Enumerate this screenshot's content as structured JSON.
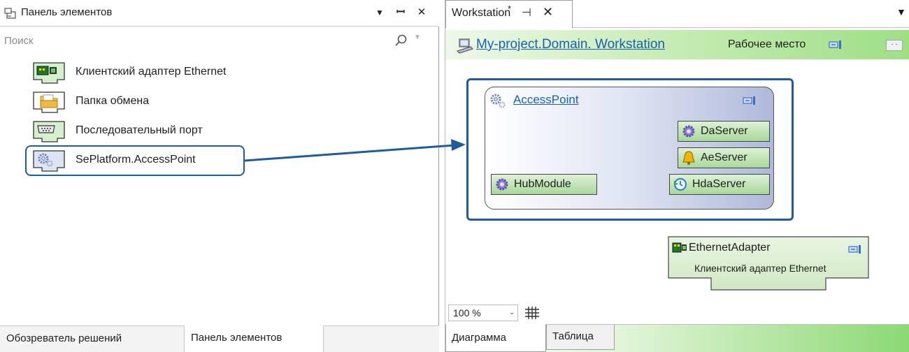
{
  "left_panel": {
    "title": "Панель элементов",
    "buttons": {
      "menu": "▼",
      "pin": "ᛘ",
      "close": "✕"
    },
    "search": {
      "placeholder": "Поиск",
      "value": ""
    },
    "items": [
      {
        "label": "Клиентский адаптер Ethernet",
        "icon": "network-adapter-icon"
      },
      {
        "label": "Папка обмена",
        "icon": "folder-icon"
      },
      {
        "label": "Последовательный порт",
        "icon": "serial-port-icon"
      },
      {
        "label": "SePlatform.AccessPoint",
        "icon": "gear-icon"
      }
    ],
    "selected_item": "SePlatform.AccessPoint",
    "tabs": [
      {
        "label": "Обозреватель решений",
        "active": false
      },
      {
        "label": "Панель элементов",
        "active": true
      }
    ]
  },
  "document": {
    "tab": {
      "title": "Workstation",
      "modified_mark": "*",
      "pin": "⊣",
      "close": "✕"
    },
    "menu_glyph": "▾",
    "breadcrumb": {
      "link": "My-project.Domain. Workstation",
      "role": "Рабочее место"
    },
    "canvas": {
      "access_point": {
        "title": "AccessPoint",
        "ports": [
          {
            "label": "DaServer",
            "icon": "gear-icon"
          },
          {
            "label": "AeServer",
            "icon": "bell-icon"
          },
          {
            "label": "HdaServer",
            "icon": "history-clock-icon"
          },
          {
            "label": "HubModule",
            "icon": "gear-icon"
          }
        ]
      },
      "ethernet_node": {
        "title": "EthernetAdapter",
        "subtitle": "Клиентский адаптер Ethernet"
      }
    },
    "zoom": {
      "value": "100 %"
    },
    "view_tabs": [
      {
        "label": "Диаграмма",
        "active": true
      },
      {
        "label": "Таблица",
        "active": false
      }
    ]
  },
  "colors": {
    "selection": "#1f5c9e",
    "accent_green": "#9edf84",
    "link": "#1a5fb4"
  }
}
